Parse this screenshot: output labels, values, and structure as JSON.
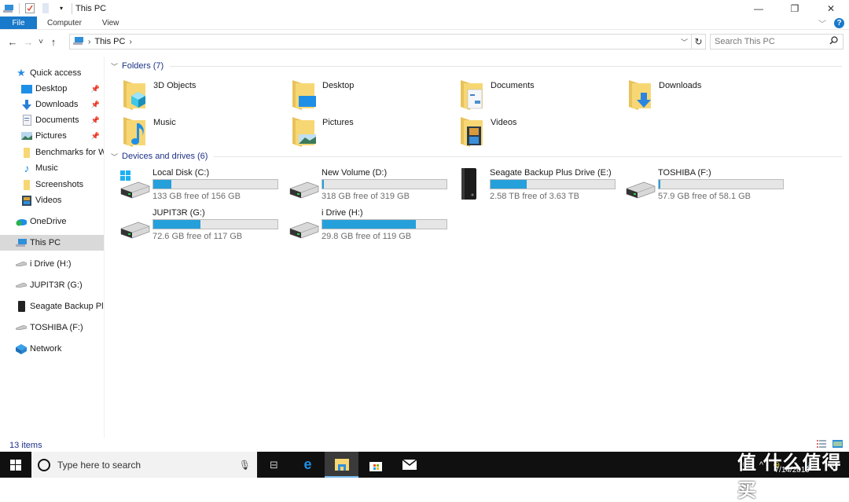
{
  "window": {
    "title": "This PC",
    "controls": {
      "minimize": "—",
      "restore": "❐",
      "close": "✕"
    }
  },
  "ribbon": {
    "tabs": [
      "File",
      "Computer",
      "View"
    ],
    "help": "?"
  },
  "nav": {
    "back": "←",
    "forward": "→",
    "recent": "˅",
    "up": "↑",
    "address": [
      "This PC"
    ],
    "refresh": "↻",
    "search_placeholder": "Search This PC"
  },
  "sidebar": {
    "quick_access_label": "Quick access",
    "quick_items": [
      {
        "label": "Desktop",
        "icon": "desktop-icon",
        "pinned": true
      },
      {
        "label": "Downloads",
        "icon": "downloads-icon",
        "pinned": true
      },
      {
        "label": "Documents",
        "icon": "documents-icon",
        "pinned": true
      },
      {
        "label": "Pictures",
        "icon": "pictures-icon",
        "pinned": true
      },
      {
        "label": "Benchmarks for Win",
        "icon": "folder-icon",
        "pinned": false
      },
      {
        "label": "Music",
        "icon": "music-icon",
        "pinned": false
      },
      {
        "label": "Screenshots",
        "icon": "folder-icon",
        "pinned": false
      },
      {
        "label": "Videos",
        "icon": "videos-icon",
        "pinned": false
      }
    ],
    "roots": [
      {
        "label": "OneDrive",
        "icon": "onedrive-icon",
        "selected": false
      },
      {
        "label": "This PC",
        "icon": "this-pc-icon",
        "selected": true
      },
      {
        "label": "i Drive (H:)",
        "icon": "drive-icon",
        "selected": false
      },
      {
        "label": "JUPIT3R (G:)",
        "icon": "drive-icon",
        "selected": false
      },
      {
        "label": "Seagate Backup Plus",
        "icon": "external-drive-icon",
        "selected": false
      },
      {
        "label": "TOSHIBA (F:)",
        "icon": "drive-icon",
        "selected": false
      },
      {
        "label": "Network",
        "icon": "network-icon",
        "selected": false
      }
    ]
  },
  "main": {
    "folders_header": "Folders (7)",
    "folders": [
      {
        "name": "3D Objects",
        "overlay": "cube"
      },
      {
        "name": "Desktop",
        "overlay": "desktop"
      },
      {
        "name": "Documents",
        "overlay": "document"
      },
      {
        "name": "Downloads",
        "overlay": "download"
      },
      {
        "name": "Music",
        "overlay": "music"
      },
      {
        "name": "Pictures",
        "overlay": "picture"
      },
      {
        "name": "Videos",
        "overlay": "video"
      }
    ],
    "drives_header": "Devices and drives (6)",
    "drives": [
      {
        "name": "Local Disk (C:)",
        "free_text": "133 GB free of 156 GB",
        "used_fraction": 0.147,
        "kind": "system"
      },
      {
        "name": "New Volume (D:)",
        "free_text": "318 GB free of 319 GB",
        "used_fraction": 0.005,
        "kind": "hdd"
      },
      {
        "name": "Seagate Backup Plus Drive (E:)",
        "free_text": "2.58 TB free of 3.63 TB",
        "used_fraction": 0.289,
        "kind": "external"
      },
      {
        "name": "TOSHIBA (F:)",
        "free_text": "57.9 GB free of 58.1 GB",
        "used_fraction": 0.003,
        "kind": "hdd"
      },
      {
        "name": "JUPIT3R (G:)",
        "free_text": "72.6 GB free of 117 GB",
        "used_fraction": 0.379,
        "kind": "hdd"
      },
      {
        "name": "i Drive (H:)",
        "free_text": "29.8 GB free of 119 GB",
        "used_fraction": 0.75,
        "kind": "hdd"
      }
    ]
  },
  "status": {
    "count": "13 items"
  },
  "taskbar": {
    "search_placeholder": "Type here to search",
    "clock_date": "7/14/2019",
    "watermark": "值 什么值得买"
  },
  "colors": {
    "accent": "#1979ca",
    "bar_fill": "#26a0da",
    "group_header": "#1e3287",
    "folder": "#f7d774"
  }
}
